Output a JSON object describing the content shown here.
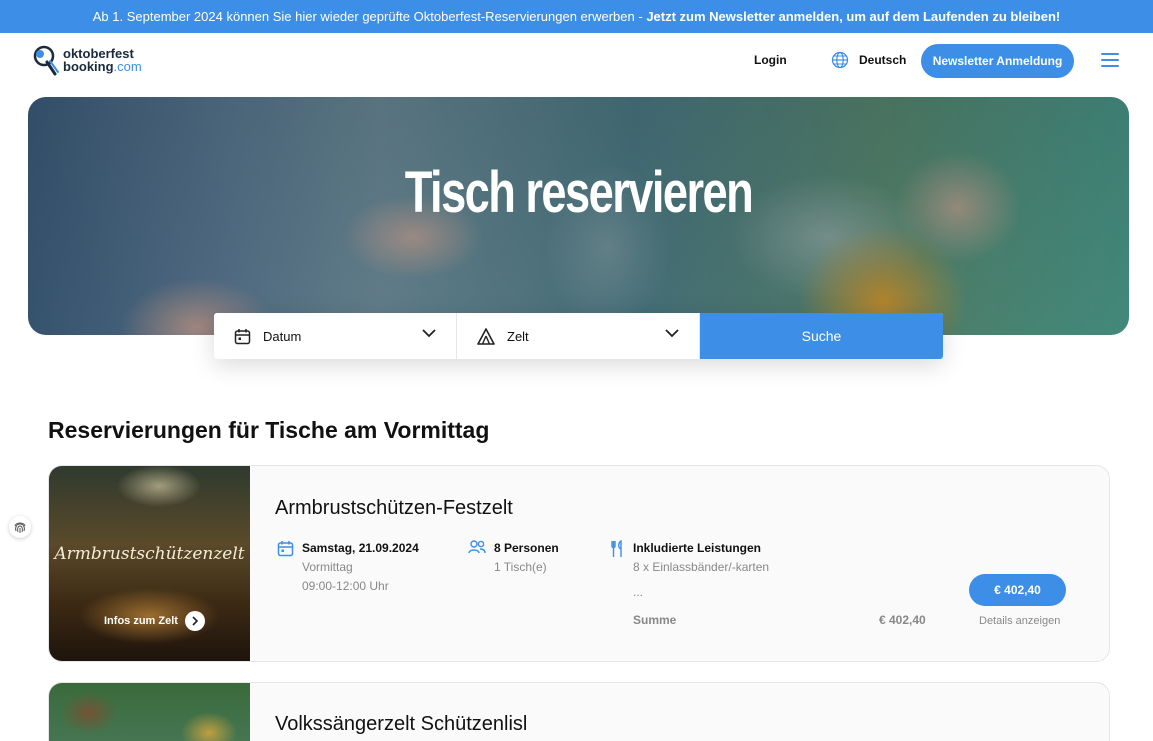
{
  "announcement": {
    "text": "Ab 1. September 2024 können Sie hier wieder geprüfte Oktoberfest-Reservierungen erwerben - ",
    "cta": "Jetzt zum Newsletter anmelden, um auf dem Laufenden zu bleiben!"
  },
  "header": {
    "logo_line1": "oktoberfest",
    "logo_line2a": "booking",
    "logo_line2b": ".com",
    "login": "Login",
    "language": "Deutsch",
    "newsletter_button": "Newsletter Anmeldung"
  },
  "hero": {
    "title": "Tisch reservieren"
  },
  "search": {
    "date_label": "Datum",
    "tent_label": "Zelt",
    "button": "Suche"
  },
  "section": {
    "title": "Reservierungen für Tische am Vormittag"
  },
  "cards": [
    {
      "image_title": "Armbrustschützenzelt",
      "image_link": "Infos zum Zelt",
      "name": "Armbrustschützen-Festzelt",
      "date": "Samstag, 21.09.2024",
      "period": "Vormittag",
      "time": "09:00-12:00 Uhr",
      "persons": "8 Personen",
      "tables": "1 Tisch(e)",
      "included_title": "Inkludierte Leistungen",
      "included_item": "8 x Einlassbänder/-karten",
      "included_more": "...",
      "sum_label": "Summe",
      "sum_value": "€ 402,40",
      "price": "€ 402,40",
      "details": "Details anzeigen"
    },
    {
      "name": "Volkssängerzelt Schützenlisl"
    }
  ],
  "colors": {
    "accent": "#3d8ee6"
  }
}
